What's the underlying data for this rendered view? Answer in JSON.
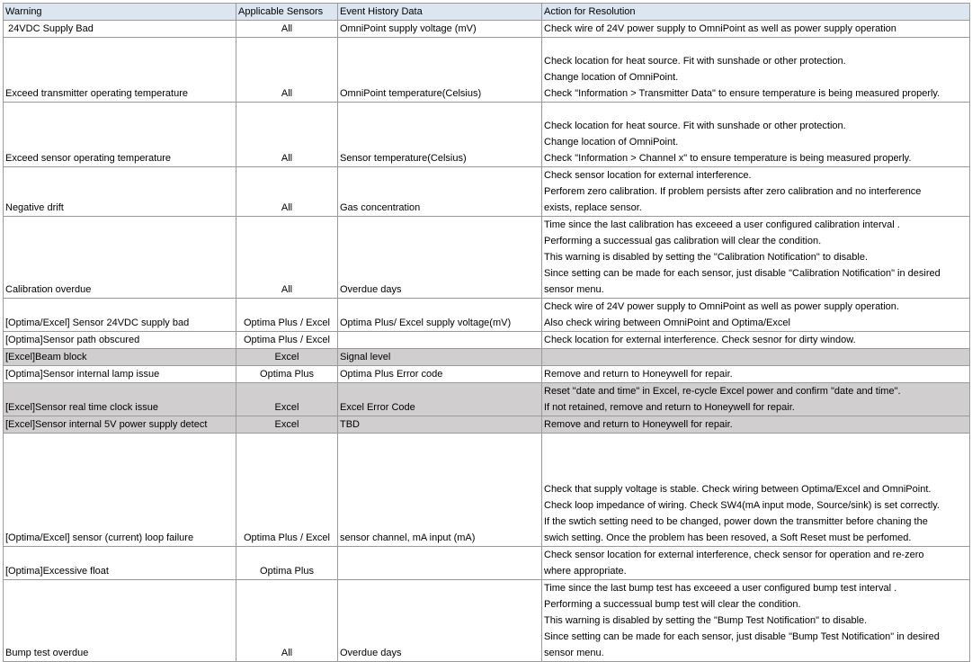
{
  "columns": [
    "Warning",
    "Applicable Sensors",
    "Event History Data",
    "Action for Resolution"
  ],
  "rows": [
    {
      "warning": " 24VDC Supply Bad",
      "sensors": "All",
      "event": "OmniPoint supply voltage (mV)",
      "action": [
        "Check wire of 24V power supply to OmniPoint as well as power supply operation"
      ],
      "lines": 1,
      "gray": false
    },
    {
      "warning": "Exceed transmitter operating temperature",
      "sensors": "All",
      "event": "OmniPoint temperature(Celsius)",
      "action": [
        "Check location for heat source. Fit with sunshade or other protection.",
        "Change location of OmniPoint.",
        "Check \"Information > Transmitter Data\" to ensure temperature is being measured properly."
      ],
      "lines": 4,
      "gray": false
    },
    {
      "warning": "Exceed sensor operating temperature",
      "sensors": "All",
      "event": "Sensor temperature(Celsius)",
      "action": [
        "Check location for heat source. Fit with sunshade or other protection.",
        "Change location of OmniPoint.",
        "Check \"Information > Channel x\" to ensure temperature is being measured properly."
      ],
      "lines": 4,
      "gray": false
    },
    {
      "warning": "Negative drift",
      "sensors": "All",
      "event": "Gas concentration",
      "action": [
        "Check sensor location for external interference.",
        "Perforem zero calibration.  If problem persists after zero calibration and no interference",
        "exists, replace sensor."
      ],
      "lines": 3,
      "gray": false
    },
    {
      "warning": "Calibration overdue",
      "sensors": "All",
      "event": "Overdue days",
      "action": [
        "Time since the last calibration has exceeed a user configured calibration interval .",
        "Performing a successual gas calibration will clear the condition.",
        "This warning is disabled by setting the \"Calibration Notification\" to disable.",
        "Since setting can be made for each sensor, just disable \"Calibration Notification\" in desired",
        "sensor menu."
      ],
      "lines": 5,
      "gray": false
    },
    {
      "warning": "[Optima/Excel] Sensor 24VDC supply bad",
      "sensors": "Optima Plus / Excel",
      "event": "Optima Plus/ Excel  supply voltage(mV)",
      "action": [
        "Check wire of 24V power supply to OmniPoint as well as power supply operation.",
        "Also check wiring between OmniPoint and Optima/Excel"
      ],
      "lines": 2,
      "gray": false
    },
    {
      "warning": "[Optima]Sensor path obscured",
      "sensors": "Optima Plus / Excel",
      "event": "",
      "action": [
        "Check location for external interference. Check sesnor for dirty window."
      ],
      "lines": 1,
      "gray": false
    },
    {
      "warning": "[Excel]Beam block",
      "sensors": "Excel",
      "event": "Signal level",
      "action": [
        ""
      ],
      "lines": 1,
      "gray": true
    },
    {
      "warning": "[Optima]Sensor internal lamp issue",
      "sensors": "Optima Plus",
      "event": "Optima Plus Error code",
      "action": [
        "Remove and return to Honeywell for repair."
      ],
      "lines": 1,
      "gray": false
    },
    {
      "warning": "[Excel]Sensor real time clock issue",
      "sensors": "Excel",
      "event": "Excel Error Code",
      "action": [
        "Reset \"date and time\" in Excel, re-cycle Excel power and confirm \"date and time\".",
        "If not retained, remove and return to Honeywell for repair."
      ],
      "lines": 2,
      "gray": true
    },
    {
      "warning": "[Excel]Sensor internal 5V power supply detect",
      "sensors": "Excel",
      "event": "TBD",
      "action": [
        "Remove and return to Honeywell for repair."
      ],
      "lines": 1,
      "gray": true
    },
    {
      "warning": "[Optima/Excel] sensor (current) loop failure",
      "sensors": "Optima Plus / Excel",
      "event": "sensor channel, mA input (mA)",
      "action": [
        "Check that supply voltage is stable. Check wiring between Optima/Excel and OmniPoint.",
        "Check loop impedance of wiring.  Check SW4(mA input mode, Source/sink) is set correctly.",
        "If the swtich setting need to be changed, power down the transmitter before chaning the",
        "swich setting.  Once the problem has been resoved, a Soft Reset must be perfomed."
      ],
      "lines": 7,
      "gray": false
    },
    {
      "warning": "[Optima]Excessive float",
      "sensors": "Optima Plus",
      "event": "",
      "action": [
        "Check sensor location for external interference, check sensor for operation and re-zero",
        "where appropriate."
      ],
      "lines": 2,
      "gray": false
    },
    {
      "warning": "Bump test overdue",
      "sensors": "All",
      "event": "Overdue days",
      "action": [
        "Time since the last bump test has exceeed a user configured bump test interval .",
        "Performing a successual bump test will clear the condition.",
        "This warning is disabled by setting the \"Bump Test Notification\" to disable.",
        "Since setting can be made for each sensor, just disable \"Bump Test Notification\" in desired",
        "sensor menu."
      ],
      "lines": 5,
      "gray": false
    }
  ]
}
